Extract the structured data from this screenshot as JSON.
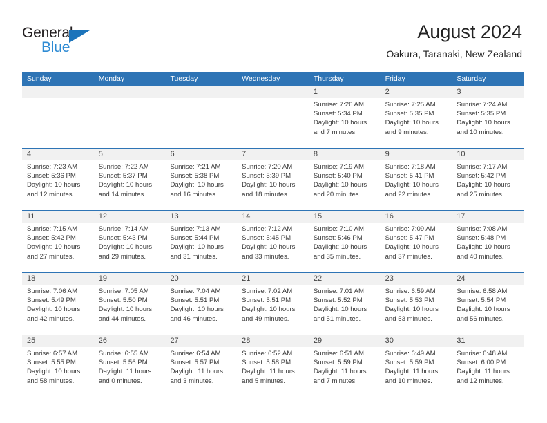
{
  "brand": {
    "name_part1": "General",
    "name_part2": "Blue",
    "triangle_color": "#1c74bb",
    "blue_color": "#2e8bd4"
  },
  "header": {
    "title": "August 2024",
    "location": "Oakura, Taranaki, New Zealand"
  },
  "theme": {
    "header_bar_color": "#2e74b5",
    "row_divider_color": "#2e74b5",
    "day_band_color": "#f1f1f1",
    "text_color": "#3a3a3a"
  },
  "weekdays": [
    "Sunday",
    "Monday",
    "Tuesday",
    "Wednesday",
    "Thursday",
    "Friday",
    "Saturday"
  ],
  "weeks": [
    [
      {
        "day": "",
        "sunrise": "",
        "sunset": "",
        "daylight1": "",
        "daylight2": "",
        "empty": true
      },
      {
        "day": "",
        "sunrise": "",
        "sunset": "",
        "daylight1": "",
        "daylight2": "",
        "empty": true
      },
      {
        "day": "",
        "sunrise": "",
        "sunset": "",
        "daylight1": "",
        "daylight2": "",
        "empty": true
      },
      {
        "day": "",
        "sunrise": "",
        "sunset": "",
        "daylight1": "",
        "daylight2": "",
        "empty": true
      },
      {
        "day": "1",
        "sunrise": "Sunrise: 7:26 AM",
        "sunset": "Sunset: 5:34 PM",
        "daylight1": "Daylight: 10 hours",
        "daylight2": "and 7 minutes."
      },
      {
        "day": "2",
        "sunrise": "Sunrise: 7:25 AM",
        "sunset": "Sunset: 5:35 PM",
        "daylight1": "Daylight: 10 hours",
        "daylight2": "and 9 minutes."
      },
      {
        "day": "3",
        "sunrise": "Sunrise: 7:24 AM",
        "sunset": "Sunset: 5:35 PM",
        "daylight1": "Daylight: 10 hours",
        "daylight2": "and 10 minutes."
      }
    ],
    [
      {
        "day": "4",
        "sunrise": "Sunrise: 7:23 AM",
        "sunset": "Sunset: 5:36 PM",
        "daylight1": "Daylight: 10 hours",
        "daylight2": "and 12 minutes."
      },
      {
        "day": "5",
        "sunrise": "Sunrise: 7:22 AM",
        "sunset": "Sunset: 5:37 PM",
        "daylight1": "Daylight: 10 hours",
        "daylight2": "and 14 minutes."
      },
      {
        "day": "6",
        "sunrise": "Sunrise: 7:21 AM",
        "sunset": "Sunset: 5:38 PM",
        "daylight1": "Daylight: 10 hours",
        "daylight2": "and 16 minutes."
      },
      {
        "day": "7",
        "sunrise": "Sunrise: 7:20 AM",
        "sunset": "Sunset: 5:39 PM",
        "daylight1": "Daylight: 10 hours",
        "daylight2": "and 18 minutes."
      },
      {
        "day": "8",
        "sunrise": "Sunrise: 7:19 AM",
        "sunset": "Sunset: 5:40 PM",
        "daylight1": "Daylight: 10 hours",
        "daylight2": "and 20 minutes."
      },
      {
        "day": "9",
        "sunrise": "Sunrise: 7:18 AM",
        "sunset": "Sunset: 5:41 PM",
        "daylight1": "Daylight: 10 hours",
        "daylight2": "and 22 minutes."
      },
      {
        "day": "10",
        "sunrise": "Sunrise: 7:17 AM",
        "sunset": "Sunset: 5:42 PM",
        "daylight1": "Daylight: 10 hours",
        "daylight2": "and 25 minutes."
      }
    ],
    [
      {
        "day": "11",
        "sunrise": "Sunrise: 7:15 AM",
        "sunset": "Sunset: 5:42 PM",
        "daylight1": "Daylight: 10 hours",
        "daylight2": "and 27 minutes."
      },
      {
        "day": "12",
        "sunrise": "Sunrise: 7:14 AM",
        "sunset": "Sunset: 5:43 PM",
        "daylight1": "Daylight: 10 hours",
        "daylight2": "and 29 minutes."
      },
      {
        "day": "13",
        "sunrise": "Sunrise: 7:13 AM",
        "sunset": "Sunset: 5:44 PM",
        "daylight1": "Daylight: 10 hours",
        "daylight2": "and 31 minutes."
      },
      {
        "day": "14",
        "sunrise": "Sunrise: 7:12 AM",
        "sunset": "Sunset: 5:45 PM",
        "daylight1": "Daylight: 10 hours",
        "daylight2": "and 33 minutes."
      },
      {
        "day": "15",
        "sunrise": "Sunrise: 7:10 AM",
        "sunset": "Sunset: 5:46 PM",
        "daylight1": "Daylight: 10 hours",
        "daylight2": "and 35 minutes."
      },
      {
        "day": "16",
        "sunrise": "Sunrise: 7:09 AM",
        "sunset": "Sunset: 5:47 PM",
        "daylight1": "Daylight: 10 hours",
        "daylight2": "and 37 minutes."
      },
      {
        "day": "17",
        "sunrise": "Sunrise: 7:08 AM",
        "sunset": "Sunset: 5:48 PM",
        "daylight1": "Daylight: 10 hours",
        "daylight2": "and 40 minutes."
      }
    ],
    [
      {
        "day": "18",
        "sunrise": "Sunrise: 7:06 AM",
        "sunset": "Sunset: 5:49 PM",
        "daylight1": "Daylight: 10 hours",
        "daylight2": "and 42 minutes."
      },
      {
        "day": "19",
        "sunrise": "Sunrise: 7:05 AM",
        "sunset": "Sunset: 5:50 PM",
        "daylight1": "Daylight: 10 hours",
        "daylight2": "and 44 minutes."
      },
      {
        "day": "20",
        "sunrise": "Sunrise: 7:04 AM",
        "sunset": "Sunset: 5:51 PM",
        "daylight1": "Daylight: 10 hours",
        "daylight2": "and 46 minutes."
      },
      {
        "day": "21",
        "sunrise": "Sunrise: 7:02 AM",
        "sunset": "Sunset: 5:51 PM",
        "daylight1": "Daylight: 10 hours",
        "daylight2": "and 49 minutes."
      },
      {
        "day": "22",
        "sunrise": "Sunrise: 7:01 AM",
        "sunset": "Sunset: 5:52 PM",
        "daylight1": "Daylight: 10 hours",
        "daylight2": "and 51 minutes."
      },
      {
        "day": "23",
        "sunrise": "Sunrise: 6:59 AM",
        "sunset": "Sunset: 5:53 PM",
        "daylight1": "Daylight: 10 hours",
        "daylight2": "and 53 minutes."
      },
      {
        "day": "24",
        "sunrise": "Sunrise: 6:58 AM",
        "sunset": "Sunset: 5:54 PM",
        "daylight1": "Daylight: 10 hours",
        "daylight2": "and 56 minutes."
      }
    ],
    [
      {
        "day": "25",
        "sunrise": "Sunrise: 6:57 AM",
        "sunset": "Sunset: 5:55 PM",
        "daylight1": "Daylight: 10 hours",
        "daylight2": "and 58 minutes."
      },
      {
        "day": "26",
        "sunrise": "Sunrise: 6:55 AM",
        "sunset": "Sunset: 5:56 PM",
        "daylight1": "Daylight: 11 hours",
        "daylight2": "and 0 minutes."
      },
      {
        "day": "27",
        "sunrise": "Sunrise: 6:54 AM",
        "sunset": "Sunset: 5:57 PM",
        "daylight1": "Daylight: 11 hours",
        "daylight2": "and 3 minutes."
      },
      {
        "day": "28",
        "sunrise": "Sunrise: 6:52 AM",
        "sunset": "Sunset: 5:58 PM",
        "daylight1": "Daylight: 11 hours",
        "daylight2": "and 5 minutes."
      },
      {
        "day": "29",
        "sunrise": "Sunrise: 6:51 AM",
        "sunset": "Sunset: 5:59 PM",
        "daylight1": "Daylight: 11 hours",
        "daylight2": "and 7 minutes."
      },
      {
        "day": "30",
        "sunrise": "Sunrise: 6:49 AM",
        "sunset": "Sunset: 5:59 PM",
        "daylight1": "Daylight: 11 hours",
        "daylight2": "and 10 minutes."
      },
      {
        "day": "31",
        "sunrise": "Sunrise: 6:48 AM",
        "sunset": "Sunset: 6:00 PM",
        "daylight1": "Daylight: 11 hours",
        "daylight2": "and 12 minutes."
      }
    ]
  ]
}
